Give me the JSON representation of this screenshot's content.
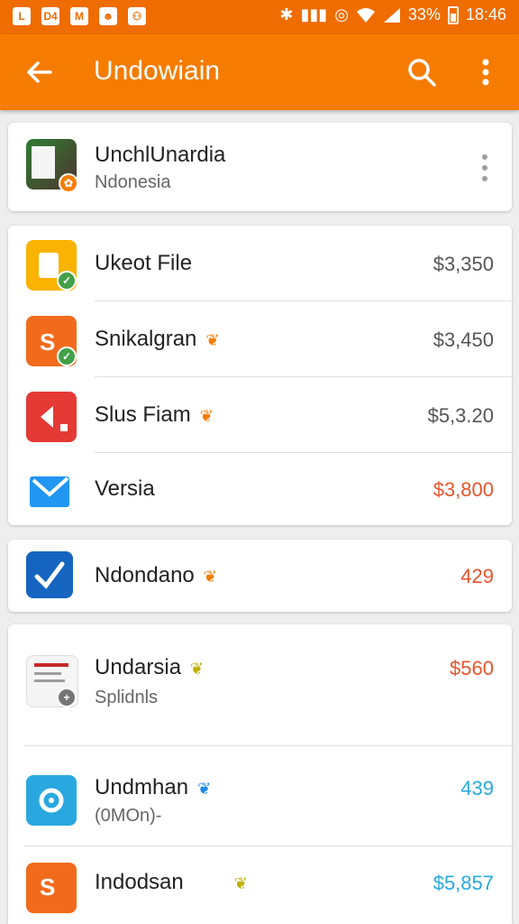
{
  "status_bar": {
    "left_icons": [
      "L",
      "D4",
      "M",
      "☻",
      "⚇"
    ],
    "battery": "33%",
    "time": "18:46",
    "right_glyphs": [
      "✱",
      "▮▮▮",
      "◎"
    ]
  },
  "app_bar": {
    "back_icon": "arrow-left-icon",
    "title": "Undowiain",
    "search_icon": "search-icon",
    "more_icon": "more-vert-icon"
  },
  "header_card": {
    "title": "UnchlUnardia",
    "subtitle": "Ndonesia"
  },
  "group1": [
    {
      "name": "Ukeot File",
      "price": "$3,350"
    },
    {
      "name": "Snikalgran",
      "price": "$3,450"
    },
    {
      "name": "Slus Fiam",
      "price": "$5,3.20"
    },
    {
      "name": "Versia",
      "price": "$3,800"
    }
  ],
  "group2": {
    "name": "Ndondano",
    "price": "429"
  },
  "group3": [
    {
      "name": "Undarsia",
      "sub": "Splidnls",
      "price": "$560"
    },
    {
      "name": "Undmhan",
      "sub": "(0MOn)-",
      "price": "439"
    },
    {
      "name": "Indodsan",
      "price": "$5,857"
    }
  ],
  "colors": {
    "accent": "#f57c00",
    "status_bar": "#ef6c00",
    "price_gray": "#555555",
    "price_red": "#e8532b",
    "price_blue": "#27a9e1"
  }
}
